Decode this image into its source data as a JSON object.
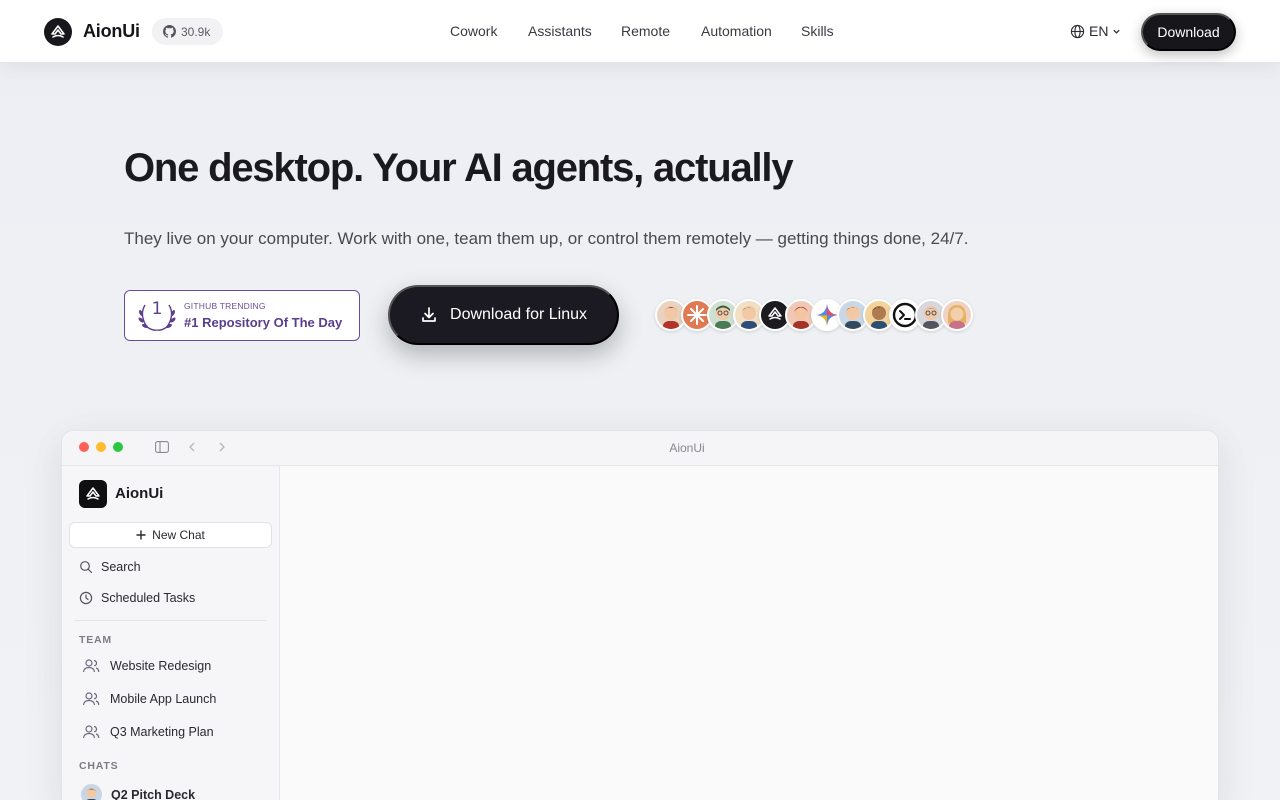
{
  "nav": {
    "brand": "AionUi",
    "github_stars": "30.9k",
    "links": [
      "Cowork",
      "Assistants",
      "Remote",
      "Automation",
      "Skills"
    ],
    "language": "EN",
    "download_label": "Download"
  },
  "hero": {
    "title": "One desktop. Your AI agents, actually",
    "subtitle": "They live on your computer. Work with one, team them up, or control them remotely — getting things done, 24/7.",
    "trending_rank": "1",
    "trending_kicker": "GITHUB TRENDING",
    "trending_title": "#1 Repository Of The Day",
    "download_label": "Download for Linux",
    "agent_avatars": [
      "agent-avatar-1",
      "agent-avatar-2",
      "agent-avatar-3",
      "agent-avatar-4",
      "agent-avatar-5",
      "agent-avatar-6",
      "agent-avatar-7",
      "agent-avatar-8",
      "agent-avatar-9",
      "agent-avatar-10",
      "agent-avatar-11",
      "agent-avatar-12"
    ]
  },
  "app": {
    "window_title": "AionUi",
    "sidebar": {
      "brand": "AionUi",
      "new_chat": "New Chat",
      "search": "Search",
      "scheduled": "Scheduled Tasks",
      "team_heading": "TEAM",
      "team_items": [
        "Website Redesign",
        "Mobile App Launch",
        "Q3 Marketing Plan"
      ],
      "chats_heading": "CHATS",
      "chat_items": [
        "Q2 Pitch Deck"
      ]
    }
  },
  "colors": {
    "accent_dark": "#17161b",
    "trending_purple": "#5a3d8c",
    "traffic_red": "#fe5f57",
    "traffic_yellow": "#febc2e",
    "traffic_green": "#28c840"
  }
}
